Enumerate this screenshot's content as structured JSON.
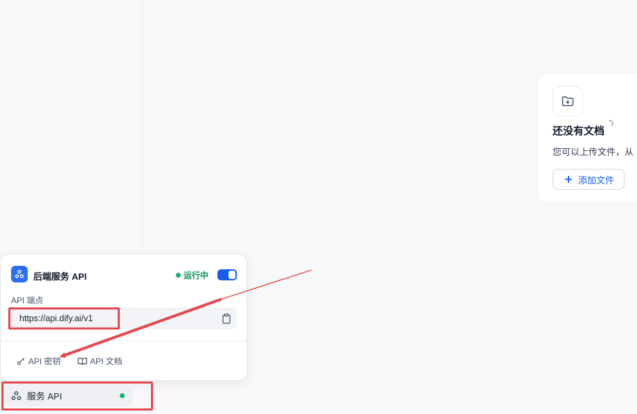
{
  "empty_state": {
    "title": "还没有文档",
    "description": "您可以上传文件，从",
    "add_button_label": "添加文件"
  },
  "api_panel": {
    "title": "后端服务 API",
    "status_text": "运行中",
    "toggle_on": true,
    "endpoint_label": "API 端点",
    "endpoint_url": "https://api.dify.ai/v1",
    "api_key_link": "API 密钥",
    "api_docs_link": "API 文档"
  },
  "nav": {
    "service_api_label": "服务 API"
  },
  "colors": {
    "accent": "#155eef",
    "status_green": "#17b26a",
    "annotation_red": "#e5484d"
  }
}
